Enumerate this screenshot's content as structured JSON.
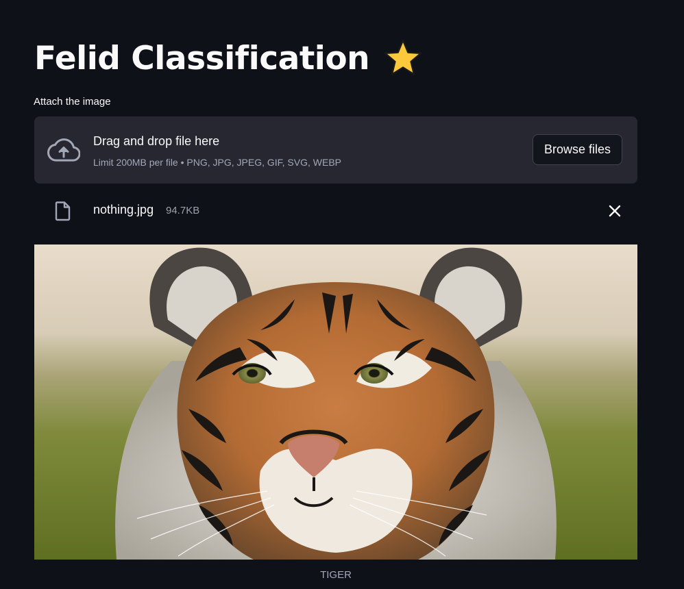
{
  "header": {
    "title": "Felid Classification",
    "title_emoji_icon": "star-icon"
  },
  "uploader": {
    "label": "Attach the image",
    "drop_text": "Drag and drop file here",
    "limit_text": "Limit 200MB per file • PNG, JPG, JPEG, GIF, SVG, WEBP",
    "browse_label": "Browse files",
    "upload_icon": "cloud-upload-icon"
  },
  "uploaded_file": {
    "name": "nothing.jpg",
    "size": "94.7KB",
    "file_icon": "file-icon",
    "remove_icon": "close-icon"
  },
  "image": {
    "subject_icon": "tiger-photo",
    "caption": "TIGER"
  },
  "colors": {
    "background": "#0e1117",
    "panel": "#262730",
    "text": "#fafafa",
    "muted_text": "#a3a8b8",
    "star": "#fcc83c"
  }
}
